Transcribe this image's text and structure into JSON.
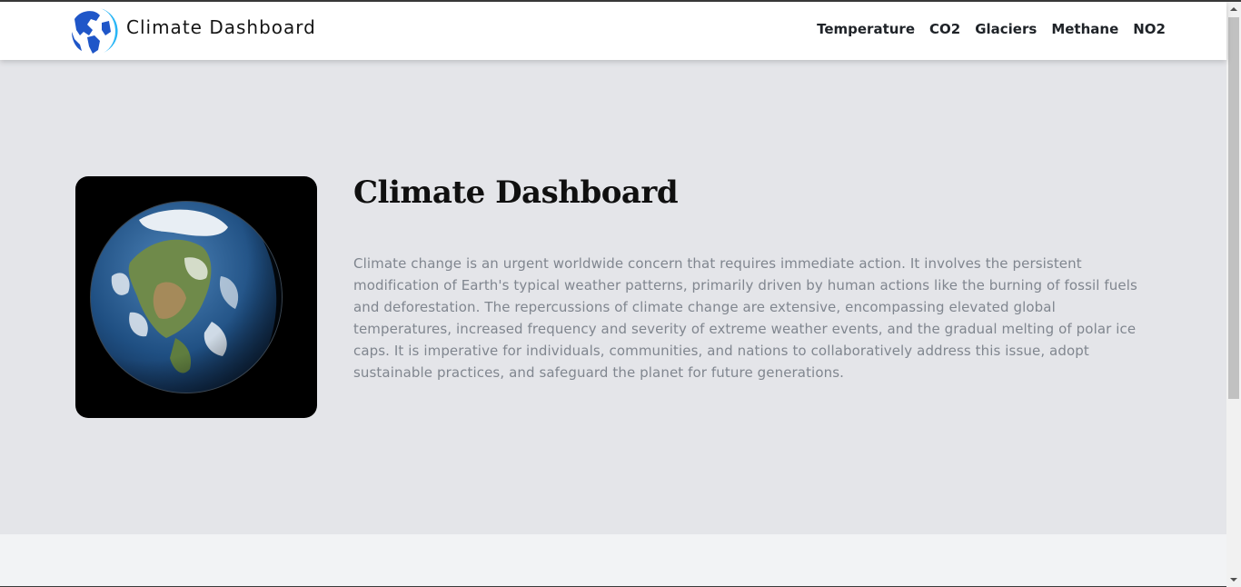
{
  "brand": {
    "title": "Climate Dashboard",
    "logo_icon": "globe-logo-icon"
  },
  "nav": {
    "items": [
      {
        "label": "Temperature"
      },
      {
        "label": "CO2"
      },
      {
        "label": "Glaciers"
      },
      {
        "label": "Methane"
      },
      {
        "label": "NO2"
      }
    ]
  },
  "hero": {
    "title": "Climate Dashboard",
    "description": "Climate change is an urgent worldwide concern that requires immediate action. It involves the persistent modification of Earth's typical weather patterns, primarily driven by human actions like the burning of fossil fuels and deforestation. The repercussions of climate change are extensive, encompassing elevated global temperatures, increased frequency and severity of extreme weather events, and the gradual melting of polar ice caps. It is imperative for individuals, communities, and nations to collaboratively address this issue, adopt sustainable practices, and safeguard the planet for future generations.",
    "image_icon": "earth-image"
  },
  "colors": {
    "navbar_bg": "#ffffff",
    "page_bg": "#e4e5e9",
    "description_text": "#80868f",
    "logo_blue": "#1f56c8",
    "logo_cyan": "#29b6f6"
  }
}
